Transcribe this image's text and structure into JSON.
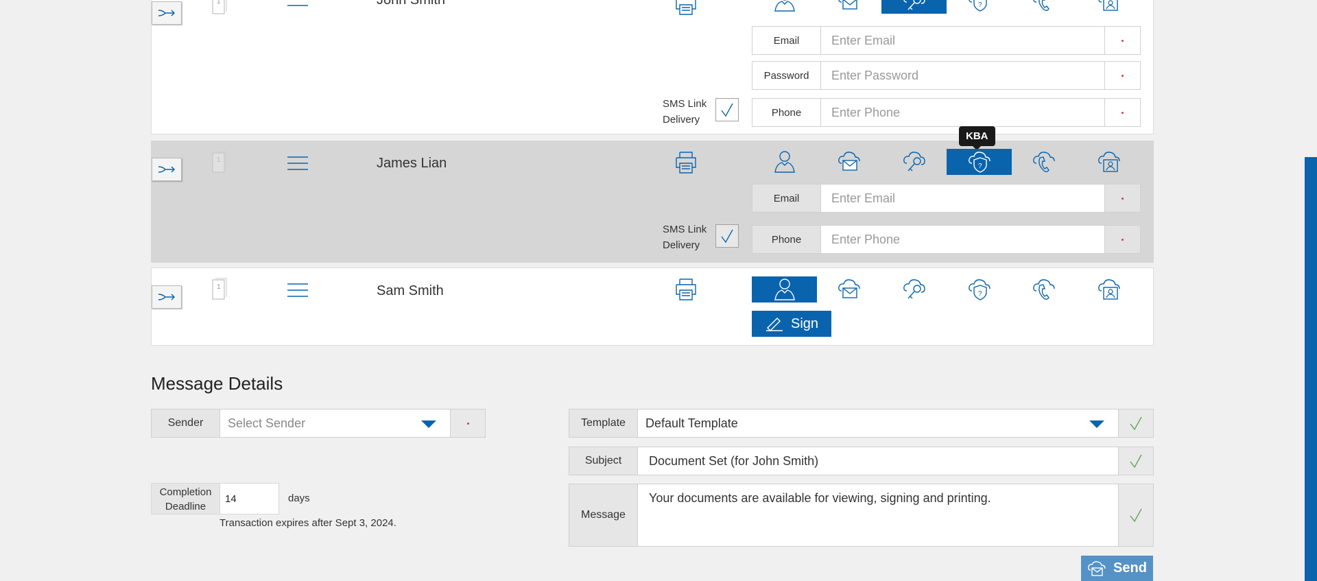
{
  "signers": [
    {
      "name": "John Smith",
      "doc_count": "1",
      "selected_auth": "password",
      "fields": [
        {
          "label": "Email",
          "placeholder": "Enter Email"
        },
        {
          "label": "Password",
          "placeholder": "Enter Password"
        },
        {
          "label": "Phone",
          "placeholder": "Enter Phone"
        }
      ],
      "sms_label": "SMS Link Delivery",
      "sms_checked": true
    },
    {
      "name": "James Lian",
      "doc_count": "1",
      "selected_auth": "kba",
      "tooltip": "KBA",
      "fields": [
        {
          "label": "Email",
          "placeholder": "Enter Email"
        },
        {
          "label": "Phone",
          "placeholder": "Enter Phone"
        }
      ],
      "sms_label": "SMS Link Delivery",
      "sms_checked": true
    },
    {
      "name": "Sam Smith",
      "doc_count": "1",
      "selected_auth": "in-person",
      "sign_label": "Sign"
    }
  ],
  "auth_icons": [
    "person-icon",
    "email-cloud-icon",
    "key-cloud-icon",
    "kba-shield-icon",
    "phone-cloud-icon",
    "id-card-cloud-icon"
  ],
  "message_details": {
    "title": "Message Details",
    "sender_label": "Sender",
    "sender_placeholder": "Select Sender",
    "deadline_label": "Completion Deadline",
    "deadline_value": "14",
    "deadline_unit": "days",
    "expiry_text": "Transaction expires after Sept 3, 2024.",
    "template_label": "Template",
    "template_value": "Default Template",
    "subject_label": "Subject",
    "subject_value": "Document Set (for John Smith)",
    "message_label": "Message",
    "message_value": "Your documents are available for viewing, signing and printing.",
    "send_label": "Send"
  },
  "colors": {
    "accent": "#0a64ad",
    "required": "#e2324a",
    "valid": "#5fa55a",
    "send": "#5592c6"
  }
}
